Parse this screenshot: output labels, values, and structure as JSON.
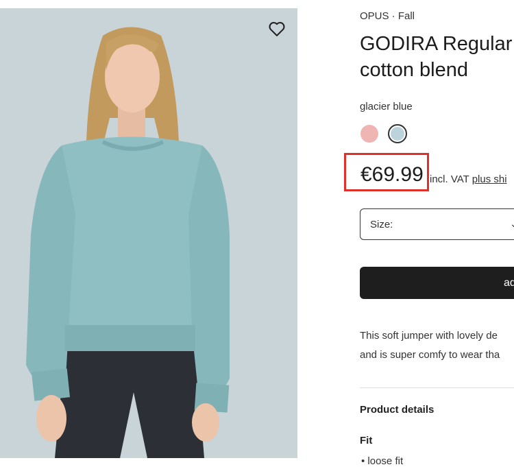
{
  "product": {
    "brand_line": "OPUS · Fall",
    "title_line1": "GODIRA Regular",
    "title_line2": "cotton blend",
    "color_name": "glacier blue",
    "swatches": [
      {
        "name": "pink",
        "color": "#efb5b2"
      },
      {
        "name": "glacier blue",
        "color": "#bcd3dc",
        "selected": true
      }
    ],
    "price": "€69.99",
    "vat_text": "incl. VAT ",
    "shipping_link": "plus shi",
    "size_label": "Size:",
    "add_button": "ad",
    "description_line1": "This soft jumper with lovely de",
    "description_line2": "and is super comfy to wear tha",
    "details_heading": "Product details",
    "fit_heading": "Fit",
    "fit_item": "• loose fit"
  },
  "colors": {
    "highlight": "#e0302a",
    "button": "#1e1e1e",
    "photo_background": "#c9d4d9"
  },
  "icons": {
    "wishlist": "heart-outline-icon",
    "size_dropdown": "chevron-down-icon"
  }
}
